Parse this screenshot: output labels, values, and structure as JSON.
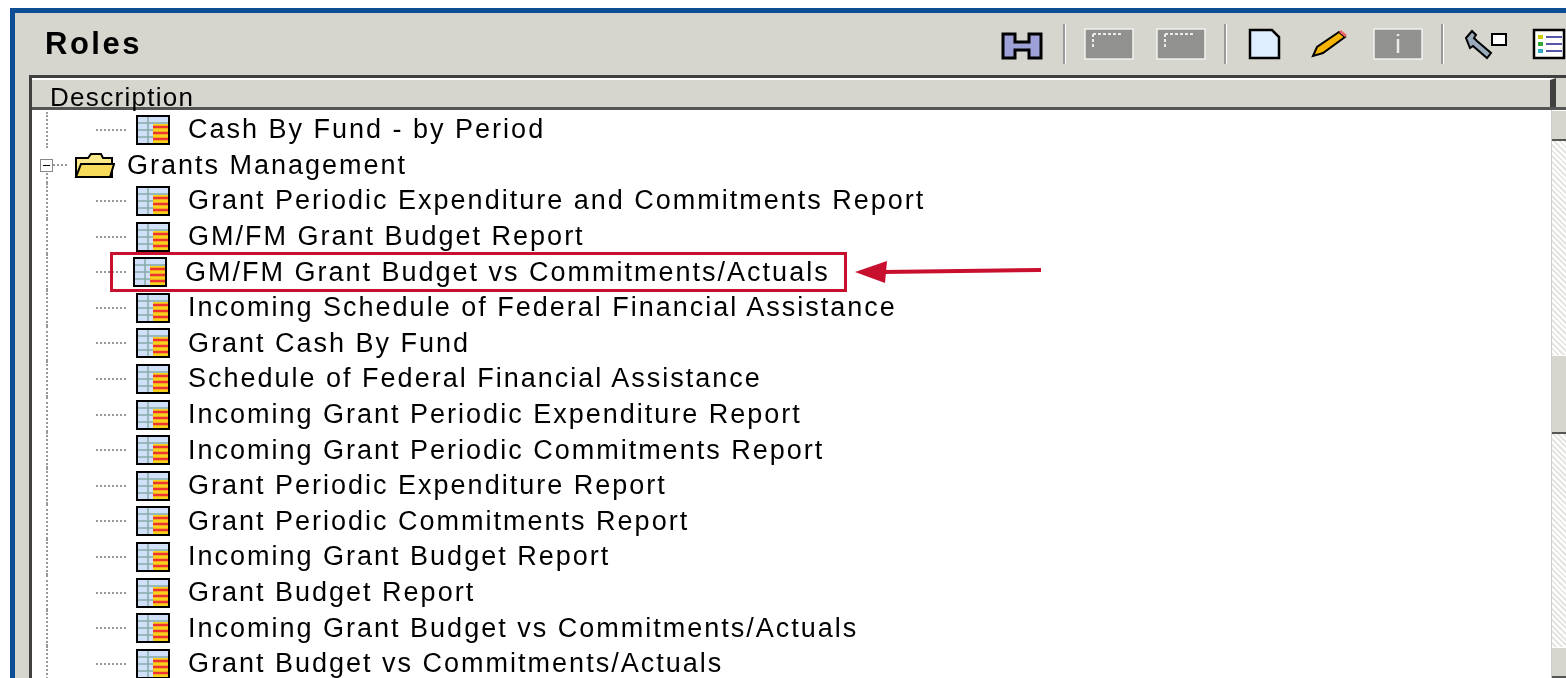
{
  "panel": {
    "title": "Roles"
  },
  "toolbar": [
    {
      "kind": "find",
      "disabled": false
    },
    {
      "kind": "separator"
    },
    {
      "kind": "grid",
      "disabled": true
    },
    {
      "kind": "grid",
      "disabled": true
    },
    {
      "kind": "separator"
    },
    {
      "kind": "new",
      "disabled": false
    },
    {
      "kind": "edit",
      "disabled": false
    },
    {
      "kind": "info",
      "disabled": true
    },
    {
      "kind": "separator"
    },
    {
      "kind": "tools",
      "disabled": false
    },
    {
      "kind": "list",
      "disabled": false
    }
  ],
  "tree": {
    "column": "Description",
    "continued_children": [
      {
        "kind": "report",
        "label": "Cash By Fund - by Period",
        "annotated": false
      }
    ],
    "nodes": [
      {
        "kind": "folder",
        "label": "Grants Management",
        "expanded": true,
        "children": [
          {
            "kind": "report",
            "label": "Grant Periodic Expenditure and Commitments Report",
            "annotated": false
          },
          {
            "kind": "report",
            "label": "GM/FM Grant Budget Report",
            "annotated": false
          },
          {
            "kind": "report",
            "label": "GM/FM Grant Budget vs Commitments/Actuals",
            "annotated": true
          },
          {
            "kind": "report",
            "label": "Incoming Schedule of Federal Financial Assistance",
            "annotated": false
          },
          {
            "kind": "report",
            "label": "Grant Cash By Fund",
            "annotated": false
          },
          {
            "kind": "report",
            "label": "Schedule of Federal Financial Assistance",
            "annotated": false
          },
          {
            "kind": "report",
            "label": "Incoming Grant Periodic Expenditure Report",
            "annotated": false
          },
          {
            "kind": "report",
            "label": "Incoming Grant Periodic Commitments Report",
            "annotated": false
          },
          {
            "kind": "report",
            "label": "Grant Periodic Expenditure Report",
            "annotated": false
          },
          {
            "kind": "report",
            "label": "Grant Periodic Commitments Report",
            "annotated": false
          },
          {
            "kind": "report",
            "label": "Incoming Grant Budget Report",
            "annotated": false
          },
          {
            "kind": "report",
            "label": "Grant Budget Report",
            "annotated": false
          },
          {
            "kind": "report",
            "label": "Incoming Grant Budget vs Commitments/Actuals",
            "annotated": false
          },
          {
            "kind": "report",
            "label": "Grant Budget vs Commitments/Actuals",
            "annotated": false
          }
        ]
      }
    ]
  }
}
